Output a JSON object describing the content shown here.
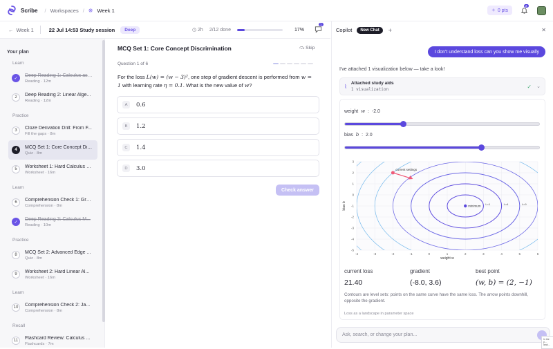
{
  "app": {
    "name": "Scribe",
    "logo_icon": "scribe-logo-icon"
  },
  "breadcrumb": {
    "items": [
      "Workspaces",
      "Week 1"
    ]
  },
  "topbar": {
    "points": "0 pts",
    "notification_count": "2"
  },
  "session": {
    "back_label": "Week 1",
    "title": "22 Jul 14:53 Study session",
    "mode_badge": "Deep",
    "duration": "2h",
    "done": "2/12 done",
    "progress_percent": "17%",
    "progress_fraction": 0.17,
    "comments_count": "1"
  },
  "sidebar": {
    "title": "Your plan",
    "groups": [
      {
        "label": "Learn",
        "items": [
          {
            "title": "Deep Reading 1: Calculus as ...",
            "meta": "Reading · 12m",
            "status": "done",
            "number": ""
          },
          {
            "title": "Deep Reading 2: Linear Alge...",
            "meta": "Reading · 12m",
            "status": "todo",
            "number": "2"
          }
        ]
      },
      {
        "label": "Practice",
        "items": [
          {
            "title": "Cloze Derivation Drill: From F...",
            "meta": "Fill the gaps · 8m",
            "status": "todo",
            "number": "3"
          },
          {
            "title": "MCQ Set 1: Core Concept Dis...",
            "meta": "Quiz · 8m",
            "status": "current",
            "number": "4"
          },
          {
            "title": "Worksheet 1: Hard Calculus E...",
            "meta": "Worksheet · 16m",
            "status": "todo",
            "number": "5"
          }
        ]
      },
      {
        "label": "Learn",
        "items": [
          {
            "title": "Comprehension Check 1: Gra...",
            "meta": "Comprehension · 8m",
            "status": "todo",
            "number": "6"
          },
          {
            "title": "Deep Reading 3: Calculus M...",
            "meta": "Reading · 10m",
            "status": "done",
            "number": ""
          }
        ]
      },
      {
        "label": "Practice",
        "items": [
          {
            "title": "MCQ Set 2: Advanced Edge ...",
            "meta": "Quiz · 8m",
            "status": "todo",
            "number": "8"
          },
          {
            "title": "Worksheet 2: Hard Linear Al...",
            "meta": "Worksheet · 16m",
            "status": "todo",
            "number": "9"
          }
        ]
      },
      {
        "label": "Learn",
        "items": [
          {
            "title": "Comprehension Check 2: Ja...",
            "meta": "Comprehension · 8m",
            "status": "todo",
            "number": "10"
          }
        ]
      },
      {
        "label": "Recall",
        "items": [
          {
            "title": "Flashcard Review: Calculus ...",
            "meta": "Flashcards · 7m",
            "status": "todo",
            "number": "11"
          }
        ]
      }
    ]
  },
  "quiz": {
    "title": "MCQ Set 1: Core Concept Discrimination",
    "skip_label": "Skip",
    "question_counter": "Question 1 of 6",
    "question_prefix": "For the loss ",
    "question_loss": "L(w) = (w − 3)²",
    "question_middle": ", one step of gradient descent is performed from ",
    "question_start": "w = 1",
    "question_mid2": " with learning rate ",
    "question_lr": "η = 0.1",
    "question_suffix": ". What is the new value of ",
    "question_var": "w",
    "question_end": "?",
    "options": [
      {
        "letter": "A",
        "value": "0.6"
      },
      {
        "letter": "B",
        "value": "1.2"
      },
      {
        "letter": "C",
        "value": "1.4"
      },
      {
        "letter": "D",
        "value": "3.0"
      }
    ],
    "check_label": "Check answer"
  },
  "copilot": {
    "title": "Copilot",
    "new_chat_label": "New Chat",
    "user_message": "I don't understand loss can you show me visually",
    "ai_message": "I've attached 1 visualization below — take a look!",
    "attachment_title": "Attached study aids",
    "attachment_sub": "1 visualization",
    "input_placeholder": "Ask, search, or change your plan..."
  },
  "viz": {
    "weight_label": "weight",
    "weight_var": "w",
    "weight_value": "-2.0",
    "weight_min": -5,
    "weight_max": 5,
    "weight": -2.0,
    "bias_label": "bias",
    "bias_var": "b",
    "bias_value": "2.0",
    "bias_min": -5,
    "bias_max": 5,
    "bias": 2.0,
    "stats": [
      {
        "label": "current loss",
        "value": "21.40"
      },
      {
        "label": "gradient",
        "value": "(-8.0, 3.6)"
      },
      {
        "label": "best point",
        "value": "(w, b) = (2, −1)"
      }
    ],
    "caption": "Contours are level sets: points on the same curve have the same loss. The arrow points downhill, opposite the gradient.",
    "subcaption": "Loss as a landscape in parameter space",
    "plot": {
      "xlabel": "weight w",
      "ylabel": "bias b",
      "xlim": [
        -4,
        6
      ],
      "ylim": [
        -5,
        3
      ],
      "minimum": [
        2,
        -1
      ],
      "minimum_label": "minimum",
      "current": [
        -2,
        2
      ],
      "current_label": "current settings",
      "contour_levels": [
        "L=1",
        "L=4",
        "L=9"
      ],
      "colors": {
        "inner": "#5b48de",
        "mid": "#6f6be6",
        "outer": "#74b9ec",
        "current": "#ef5b78"
      }
    }
  },
  "tooltip": {
    "text": "In the p... land..."
  }
}
